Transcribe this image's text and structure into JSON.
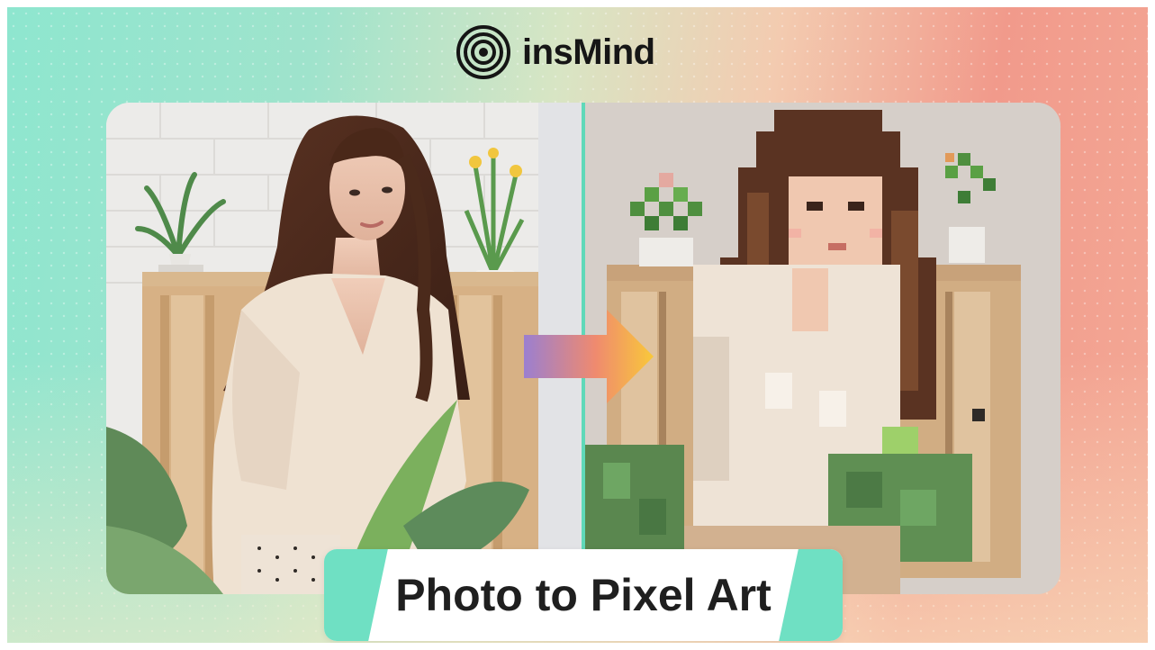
{
  "brand": {
    "logo_icon": "concentric-rings-icon",
    "name": "insMind"
  },
  "caption": {
    "text": "Photo to Pixel Art"
  },
  "colors": {
    "accent_mint": "#6fe0c3",
    "background_left": "#8ee6cf",
    "background_right": "#f19a8b",
    "arrow_start": "#9b7fd0",
    "arrow_end": "#f9c83a"
  },
  "icons": {
    "arrow": "arrow-right-icon"
  }
}
